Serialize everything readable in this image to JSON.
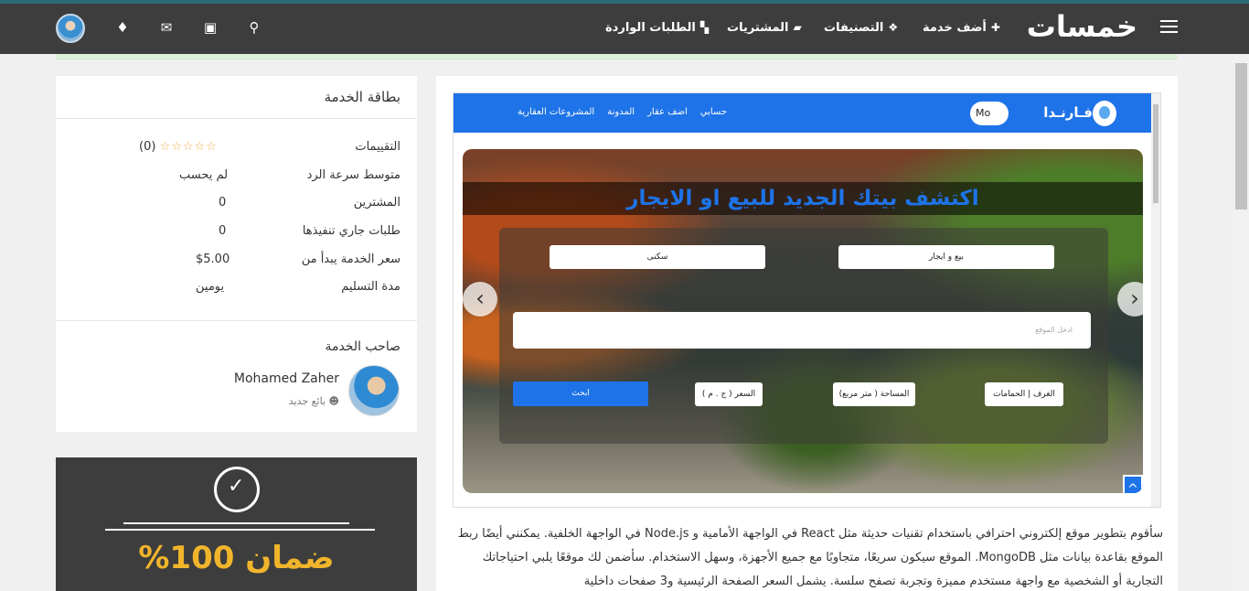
{
  "header": {
    "logo": "خمسات",
    "nav": [
      {
        "label": "أضف خدمة",
        "icon": "plus-icon"
      },
      {
        "label": "التصنيفات",
        "icon": "cubes-icon"
      },
      {
        "label": "المشتريات",
        "icon": "folder-open-icon"
      },
      {
        "label": "الطلبات الواردة",
        "icon": "truck-icon"
      }
    ],
    "icons": [
      "search-icon",
      "cart-icon",
      "envelope-icon",
      "bell-icon",
      "avatar"
    ]
  },
  "preview": {
    "brand": "فـارنـدا",
    "user_chip": "Mo",
    "nav_links": [
      "حسابي",
      "اضف عقار",
      "المدونة",
      "المشروعات العقارية"
    ],
    "hero_title": "اكتشف بيتك الجديد للبيع او الايجار",
    "select_type": "بيع و ايجار",
    "select_category": "سكنى",
    "location_placeholder": "ادخل الموقع",
    "filter_rooms": "الغرف | الحمامات",
    "filter_area": "المساحة ( متر مربع)",
    "filter_price": "السعر ( ج . م )",
    "search_button": "ابحث"
  },
  "description": "سأقوم بتطوير موقع إلكتروني احترافي باستخدام تقنيات حديثة مثل React في الواجهة الأمامية و Node.js في الواجهة الخلفية. يمكنني أيضًا ربط الموقع بقاعدة بيانات مثل MongoDB. الموقع سيكون سريعًا، متجاوبًا مع جميع الأجهزة، وسهل الاستخدام. سأضمن لك موقعًا يلبي احتياجاتك التجارية أو الشخصية مع واجهة مستخدم مميزة وتجربة تصفح سلسة. يشمل السعر الصفحة الرئيسية و3 صفحات داخلية",
  "service_card": {
    "title": "بطاقة الخدمة",
    "rows": [
      {
        "label": "التقييمات",
        "value": "(0)"
      },
      {
        "label": "متوسط سرعة الرد",
        "value": "لم يحسب"
      },
      {
        "label": "المشترين",
        "value": "0"
      },
      {
        "label": "طلبات جاري تنفيذها",
        "value": "0"
      },
      {
        "label": "سعر الخدمة يبدأ من",
        "value": "$5.00"
      },
      {
        "label": "مدة التسليم",
        "value": "يومين"
      }
    ],
    "stars": "☆☆☆☆☆",
    "owner_title": "صاحب الخدمة",
    "owner_name": "Mohamed Zaher",
    "owner_level": "بائع جديد"
  },
  "guarantee": {
    "text": "ضمان 100%"
  },
  "colors": {
    "topbar": "#3d3d3d",
    "accent_blue": "#1e73e8",
    "gold": "#f1b52b"
  }
}
